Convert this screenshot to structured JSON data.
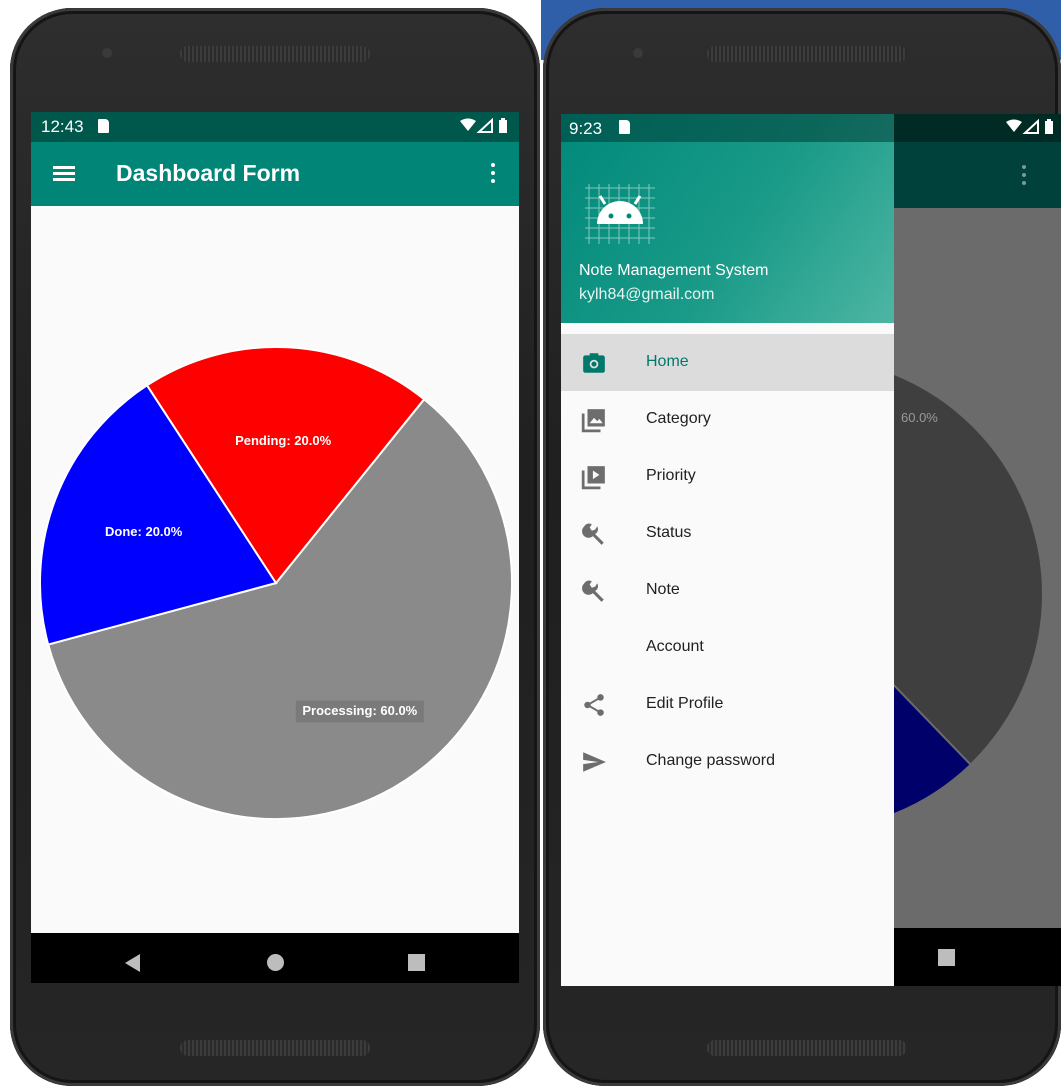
{
  "left_phone": {
    "status_time": "12:43",
    "app_title": "Dashboard Form",
    "chart_data": {
      "type": "pie",
      "title": "",
      "slices": [
        {
          "label": "Processing: 60.0%",
          "category": "Processing",
          "value": 60.0,
          "color": "#8a8a8a"
        },
        {
          "label": "Done: 20.0%",
          "category": "Done",
          "value": 20.0,
          "color": "#0000ff"
        },
        {
          "label": "Pending: 20.0%",
          "category": "Pending",
          "value": 20.0,
          "color": "#ff0000"
        }
      ]
    }
  },
  "right_phone": {
    "status_time": "9:23",
    "background_label": "60.0%",
    "drawer": {
      "header": {
        "title": "Note Management System",
        "email": "kylh84@gmail.com"
      },
      "items": [
        {
          "label": "Home",
          "icon": "camera-icon",
          "active": true
        },
        {
          "label": "Category",
          "icon": "gallery-icon",
          "active": false
        },
        {
          "label": "Priority",
          "icon": "slideshow-icon",
          "active": false
        },
        {
          "label": "Status",
          "icon": "wrench-icon",
          "active": false
        },
        {
          "label": "Note",
          "icon": "wrench-icon",
          "active": false
        },
        {
          "label": "Account",
          "icon": "",
          "active": false
        },
        {
          "label": "Edit Profile",
          "icon": "share-icon",
          "active": false
        },
        {
          "label": "Change password",
          "icon": "send-icon",
          "active": false
        }
      ]
    }
  },
  "colors": {
    "primary": "#008577",
    "primary_dark": "#00574b",
    "accent_active": "#00796b"
  }
}
